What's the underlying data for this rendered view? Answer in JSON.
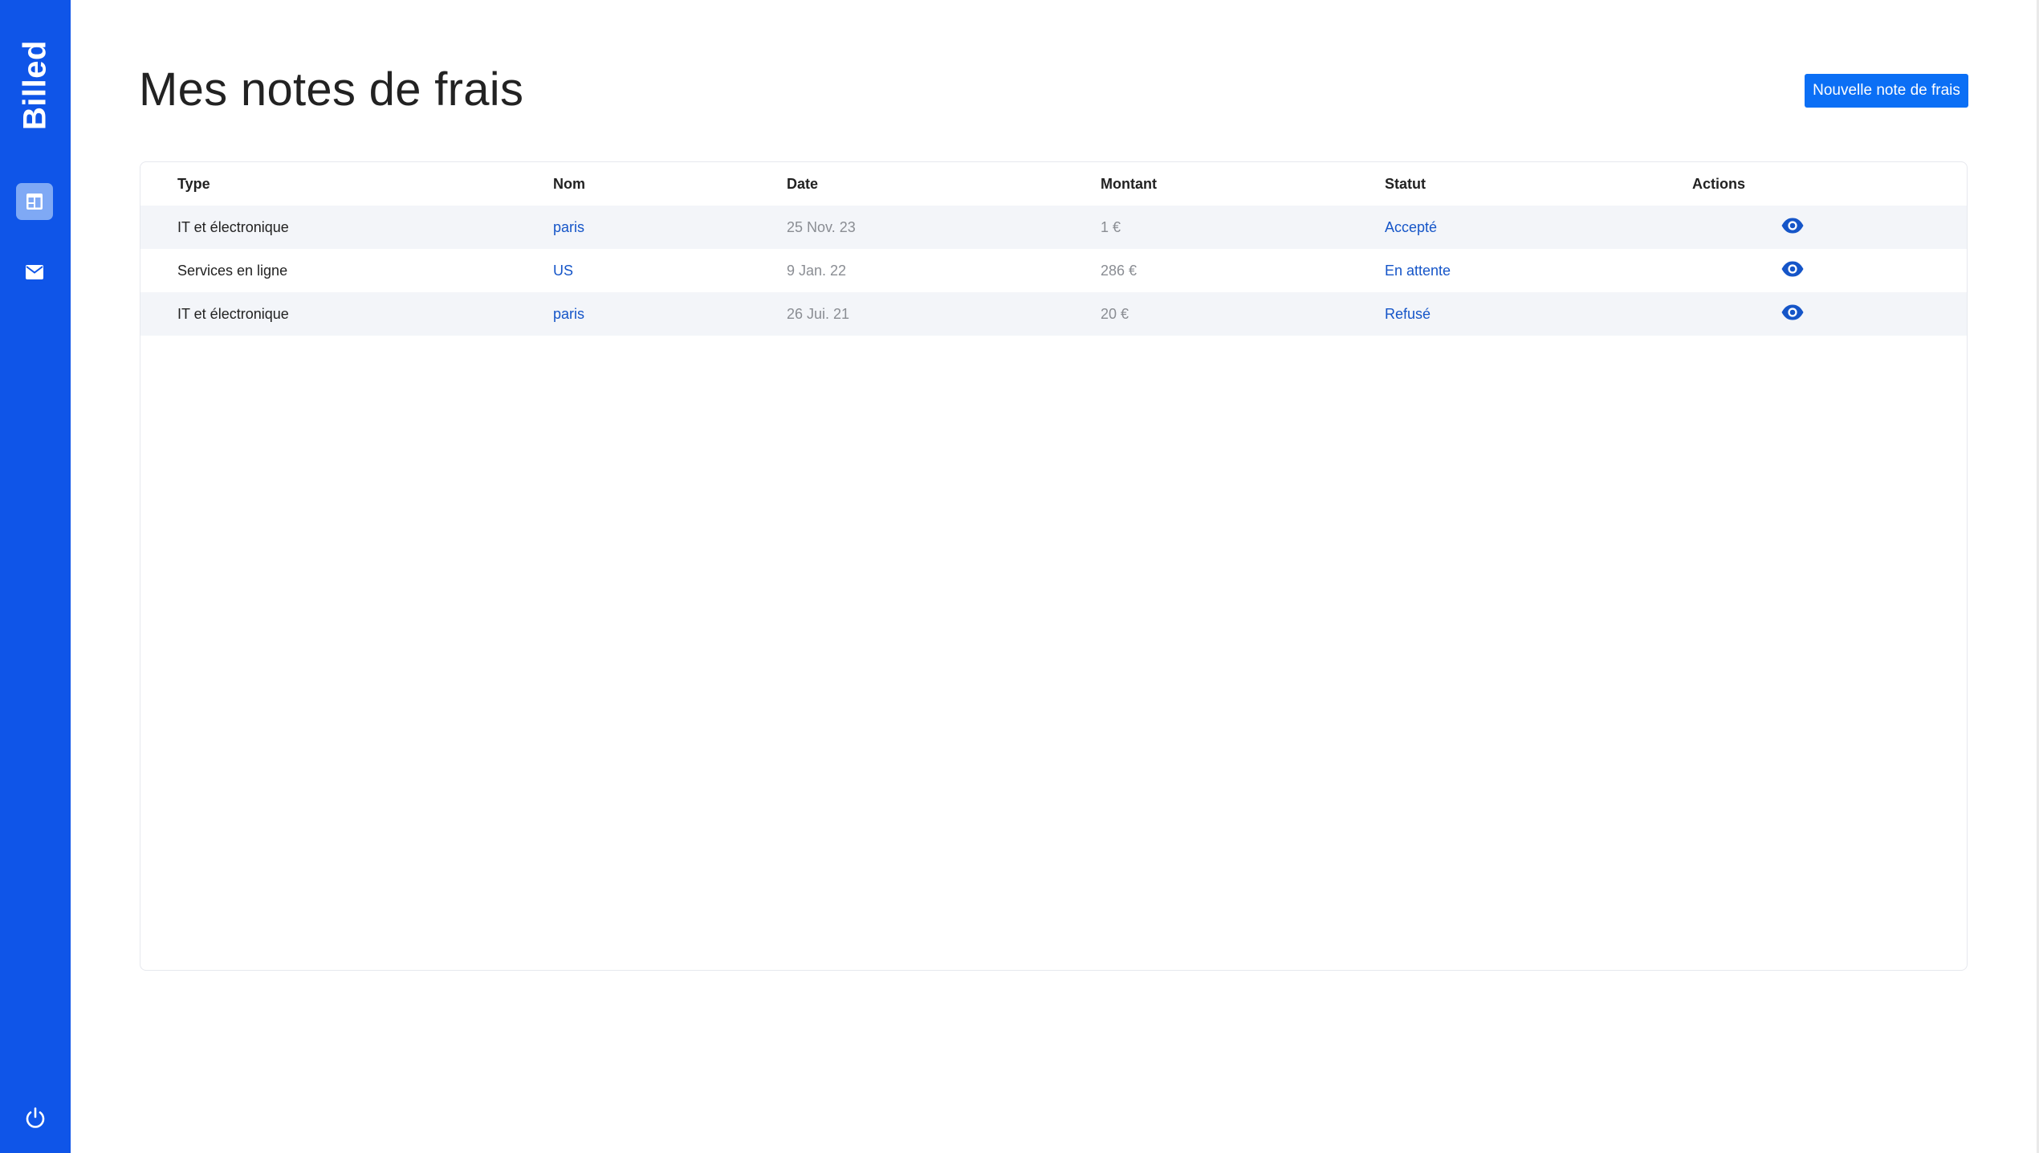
{
  "app": {
    "brand": "Billed"
  },
  "sidebar": {
    "items": [
      {
        "name": "dashboard",
        "icon": "window-icon",
        "active": true
      },
      {
        "name": "mail",
        "icon": "mail-icon",
        "active": false
      }
    ],
    "logout_icon": "power-icon"
  },
  "header": {
    "title": "Mes notes de frais",
    "new_button_label": "Nouvelle note de frais"
  },
  "table": {
    "columns": [
      "Type",
      "Nom",
      "Date",
      "Montant",
      "Statut",
      "Actions"
    ],
    "rows": [
      {
        "type": "IT et électronique",
        "nom": "paris",
        "date": "25 Nov. 23",
        "montant": "1 €",
        "statut": "Accepté",
        "action_icon": "eye-icon"
      },
      {
        "type": "Services en ligne",
        "nom": "US",
        "date": "9 Jan. 22",
        "montant": "286 €",
        "statut": "En attente",
        "action_icon": "eye-icon"
      },
      {
        "type": "IT et électronique",
        "nom": "paris",
        "date": "26 Jui. 21",
        "montant": "20 €",
        "statut": "Refusé",
        "action_icon": "eye-icon"
      }
    ]
  },
  "colors": {
    "sidebar": "#0f55e8",
    "button": "#0b6ff5",
    "link": "#1555c8",
    "row_stripe": "#f3f5f9"
  }
}
